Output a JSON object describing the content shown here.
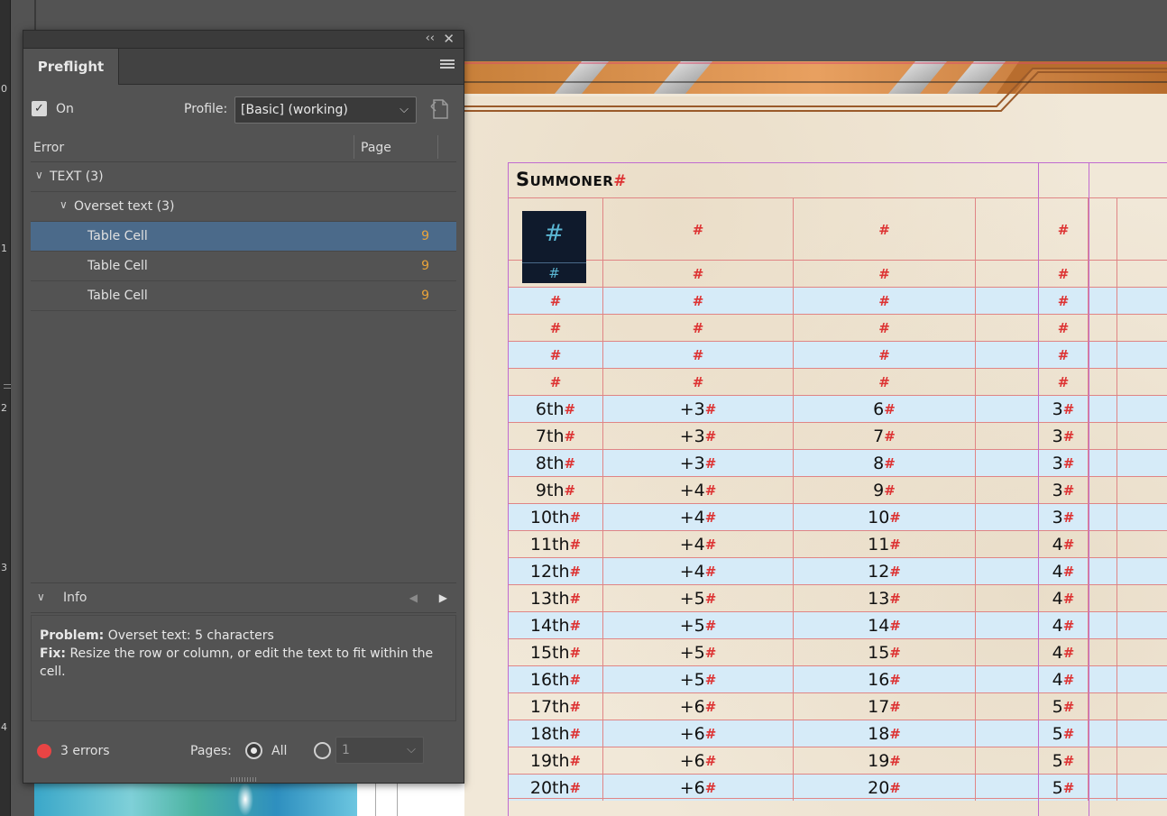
{
  "ruler": {
    "marks": [
      "0",
      "1",
      "2",
      "3",
      "4"
    ]
  },
  "panel": {
    "tab_title": "Preflight",
    "collapse_glyph": "‹‹",
    "close_glyph": "✕",
    "on_label": "On",
    "on_checked": true,
    "profile_label": "Profile:",
    "profile_value": "[Basic] (working)",
    "columns": {
      "error": "Error",
      "page": "Page"
    },
    "tree": {
      "group": "TEXT (3)",
      "subgroup": "Overset text (3)",
      "items": [
        {
          "label": "Table Cell",
          "page": "9",
          "selected": true
        },
        {
          "label": "Table Cell",
          "page": "9",
          "selected": false
        },
        {
          "label": "Table Cell",
          "page": "9",
          "selected": false
        }
      ]
    },
    "info": {
      "label": "Info",
      "problem_label": "Problem:",
      "problem_text": "Overset text: 5 characters",
      "fix_label": "Fix:",
      "fix_text": "Resize the row or column, or edit the text to fit within the cell."
    },
    "footer": {
      "errors": "3 errors",
      "pages_label": "Pages:",
      "all_label": "All",
      "range_value": "1"
    },
    "colors": {
      "selected_row": "#4b6a8a",
      "page_number": "#e8a33a",
      "error_dot": "#e94444"
    }
  },
  "document": {
    "table_title": "Summoner",
    "hash": "#",
    "rows": [
      {
        "level": "6th",
        "bonus": "+3",
        "c3": "6",
        "c5": "3"
      },
      {
        "level": "7th",
        "bonus": "+3",
        "c3": "7",
        "c5": "3"
      },
      {
        "level": "8th",
        "bonus": "+3",
        "c3": "8",
        "c5": "3"
      },
      {
        "level": "9th",
        "bonus": "+4",
        "c3": "9",
        "c5": "3"
      },
      {
        "level": "10th",
        "bonus": "+4",
        "c3": "10",
        "c5": "3"
      },
      {
        "level": "11th",
        "bonus": "+4",
        "c3": "11",
        "c5": "4"
      },
      {
        "level": "12th",
        "bonus": "+4",
        "c3": "12",
        "c5": "4"
      },
      {
        "level": "13th",
        "bonus": "+5",
        "c3": "13",
        "c5": "4"
      },
      {
        "level": "14th",
        "bonus": "+5",
        "c3": "14",
        "c5": "4"
      },
      {
        "level": "15th",
        "bonus": "+5",
        "c3": "15",
        "c5": "4"
      },
      {
        "level": "16th",
        "bonus": "+5",
        "c3": "16",
        "c5": "4"
      },
      {
        "level": "17th",
        "bonus": "+6",
        "c3": "17",
        "c5": "5"
      },
      {
        "level": "18th",
        "bonus": "+6",
        "c3": "18",
        "c5": "5"
      },
      {
        "level": "19th",
        "bonus": "+6",
        "c3": "19",
        "c5": "5"
      },
      {
        "level": "20th",
        "bonus": "+6",
        "c3": "20",
        "c5": "5"
      }
    ],
    "colors": {
      "blue_row": "#d6ebf8",
      "hash_red": "#dd3333",
      "guide_purple": "#c06bd0",
      "cell_border": "#e08585"
    }
  }
}
